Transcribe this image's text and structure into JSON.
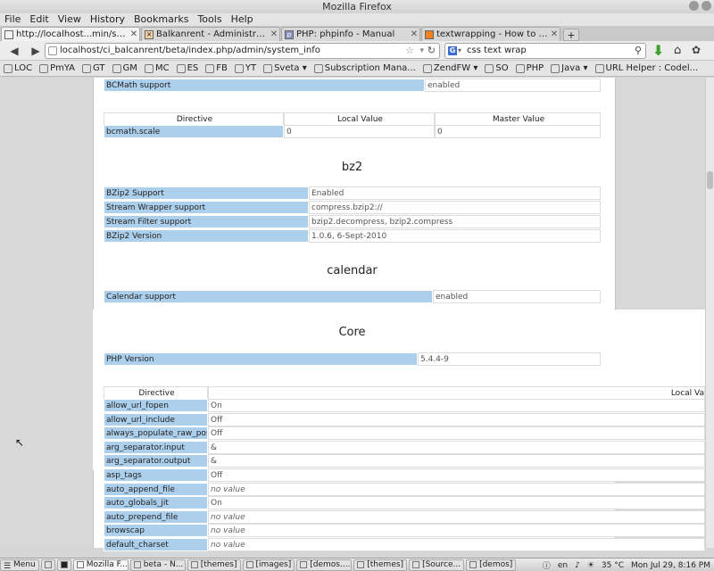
{
  "window": {
    "title": "Mozilla Firefox"
  },
  "menu": [
    "File",
    "Edit",
    "View",
    "History",
    "Bookmarks",
    "Tools",
    "Help"
  ],
  "tabs": [
    {
      "label": "http://localhost...min/system_info",
      "icon": "page-icon",
      "active": true
    },
    {
      "label": "Balkanrent - Administration",
      "icon": "close-x-icon",
      "active": false
    },
    {
      "label": "PHP: phpinfo - Manual",
      "icon": "php-icon",
      "active": false
    },
    {
      "label": "textwrapping - How to wrap te...",
      "icon": "stackoverflow-icon",
      "active": false
    }
  ],
  "newtab_label": "+",
  "nav": {
    "url": "localhost/ci_balcanrent/beta/index.php/admin/system_info",
    "search_value": "css text wrap",
    "search_engine": "G"
  },
  "bookmarks": [
    {
      "label": "LOC",
      "icon": "page-icon"
    },
    {
      "label": "PmYA",
      "icon": "p-icon"
    },
    {
      "label": "GT",
      "icon": "translate-icon"
    },
    {
      "label": "GM",
      "icon": "gmail-icon"
    },
    {
      "label": "MC",
      "icon": "mc-icon"
    },
    {
      "label": "ES",
      "icon": "es-icon"
    },
    {
      "label": "FB",
      "icon": "facebook-icon"
    },
    {
      "label": "YT",
      "icon": "youtube-icon"
    },
    {
      "label": "Sveta ▾",
      "icon": "folder-icon"
    },
    {
      "label": "Subscription Mana...",
      "icon": "subscription-icon"
    },
    {
      "label": "ZendFW ▾",
      "icon": "folder-icon"
    },
    {
      "label": "SO",
      "icon": "stackoverflow-icon"
    },
    {
      "label": "PHP",
      "icon": "php-icon"
    },
    {
      "label": "Java ▾",
      "icon": "folder-icon"
    },
    {
      "label": "URL Helper : Codel...",
      "icon": "page-icon"
    }
  ],
  "phpinfo": {
    "bcmath": {
      "support_key": "BCMath support",
      "support_val": "enabled",
      "headers": [
        "Directive",
        "Local Value",
        "Master Value"
      ],
      "scale_key": "bcmath.scale",
      "scale_local": "0",
      "scale_master": "0"
    },
    "bz2": {
      "title": "bz2",
      "rows": [
        {
          "key": "BZip2 Support",
          "val": "Enabled"
        },
        {
          "key": "Stream Wrapper support",
          "val": "compress.bzip2://"
        },
        {
          "key": "Stream Filter support",
          "val": "bzip2.decompress, bzip2.compress"
        },
        {
          "key": "BZip2 Version",
          "val": "1.0.6, 6-Sept-2010"
        }
      ]
    },
    "calendar": {
      "title": "calendar",
      "support_key": "Calendar support",
      "support_val": "enabled"
    },
    "core": {
      "title": "Core",
      "version_key": "PHP Version",
      "version_val": "5.4.4-9",
      "headers": [
        "Directive",
        "Local Va"
      ],
      "rows": [
        {
          "key": "allow_url_fopen",
          "val": "On",
          "italic": false
        },
        {
          "key": "allow_url_include",
          "val": "Off",
          "italic": false
        },
        {
          "key": "always_populate_raw_post_data",
          "val": "Off",
          "italic": false
        },
        {
          "key": "arg_separator.input",
          "val": "&",
          "italic": false
        },
        {
          "key": "arg_separator.output",
          "val": "&",
          "italic": false
        },
        {
          "key": "asp_tags",
          "val": "Off",
          "italic": false
        },
        {
          "key": "auto_append_file",
          "val": "no value",
          "italic": true
        },
        {
          "key": "auto_globals_jit",
          "val": "On",
          "italic": false
        },
        {
          "key": "auto_prepend_file",
          "val": "no value",
          "italic": true
        },
        {
          "key": "browscap",
          "val": "no value",
          "italic": true
        },
        {
          "key": "default_charset",
          "val": "no value",
          "italic": true
        }
      ]
    }
  },
  "taskbar": {
    "menu_label": "Menu",
    "items": [
      {
        "label": "Mozilla F...",
        "active": true
      },
      {
        "label": "beta - N...",
        "active": false
      },
      {
        "label": "[themes]",
        "active": false
      },
      {
        "label": "[images]",
        "active": false
      },
      {
        "label": "[demos....",
        "active": false
      },
      {
        "label": "[themes]",
        "active": false
      },
      {
        "label": "[Source...",
        "active": false
      },
      {
        "label": "[demos]",
        "active": false
      }
    ],
    "lang": "en",
    "temp": "35 °C",
    "clock": "Mon Jul 29,  8:16 PM"
  },
  "colors": {
    "key_bg": "#accfec",
    "page_bg": "#ffffff"
  }
}
